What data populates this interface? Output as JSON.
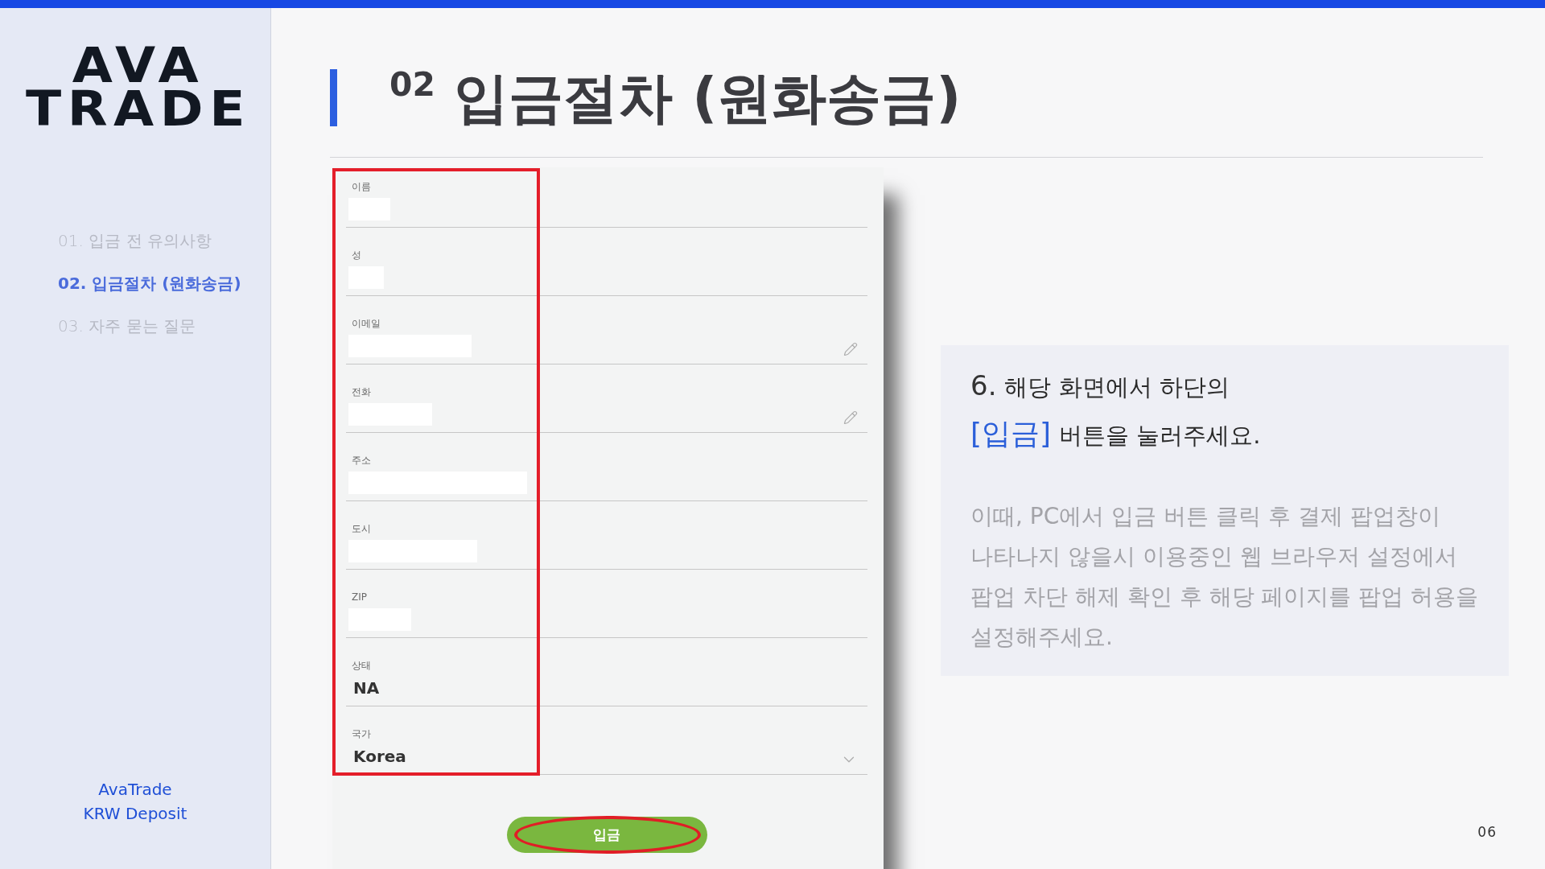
{
  "logo": {
    "top": "AVA",
    "bottom": "TRADE"
  },
  "sidebar": {
    "items": [
      {
        "label": "01. 입금 전 유의사항",
        "selected": false
      },
      {
        "label": "02. 입금절차 (원화송금)",
        "selected": true
      },
      {
        "label": "03. 자주 묻는 질문",
        "selected": false
      }
    ],
    "footer": {
      "brand": "AvaTrade",
      "subtitle": "KRW Deposit"
    }
  },
  "title": "$^{02}$ 입금절차 (원화송금)",
  "form": {
    "highlighted": true,
    "fields": [
      {
        "kind": "text",
        "label": "이름",
        "redacted": true,
        "editable": false
      },
      {
        "kind": "text",
        "label": "성",
        "redacted": true,
        "editable": false
      },
      {
        "kind": "text",
        "label": "이메일",
        "redacted": true,
        "editable": true
      },
      {
        "kind": "text",
        "label": "전화",
        "redacted": true,
        "editable": true
      },
      {
        "kind": "text",
        "label": "주소",
        "redacted": true,
        "editable": false
      },
      {
        "kind": "text",
        "label": "도시",
        "redacted": true,
        "editable": false
      },
      {
        "kind": "text",
        "label": "ZIP",
        "redacted": true,
        "editable": false
      },
      {
        "kind": "text",
        "label": "상태",
        "value": "NA",
        "redacted": false,
        "editable": false
      },
      {
        "kind": "select",
        "label": "국가",
        "value": "Korea",
        "redacted": false,
        "editable": false
      }
    ],
    "submit_button": {
      "label": "입금",
      "highlighted": true
    }
  },
  "callout": {
    "step_number": "6.",
    "line_1": "해당 화면에서 하단의",
    "button_ref": "[입금]",
    "line_2": "버튼을 눌러주세요.",
    "note": "이때, PC에서 입금 버튼 클릭 후 결제 팝업창이\n나타나지 않을시 이용중인 웹 브라우저 설정에서\n팝업 차단 해제 확인 후 해당 페이지를 팝업 허용을\n설정해주세요."
  },
  "page_number": "06"
}
